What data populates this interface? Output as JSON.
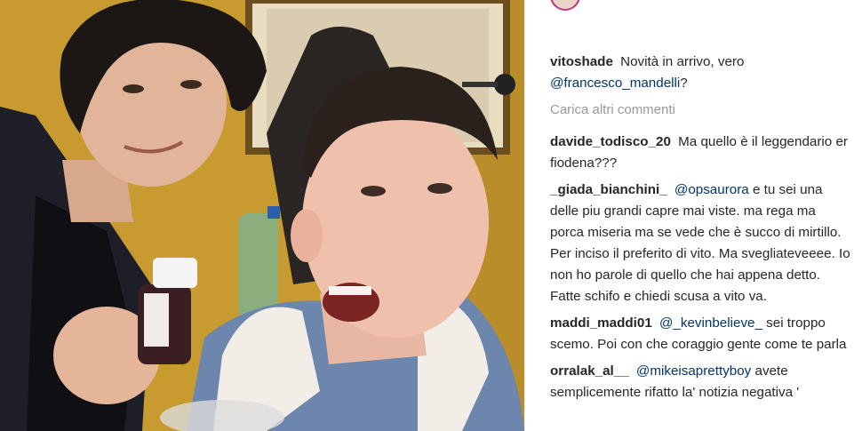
{
  "post": {
    "photo_alt": "Selfie di due uomini, uno con una bottiglia di sciroppo",
    "bottle_label": ""
  },
  "header": {
    "avatar_icon": "profile-avatar-icon"
  },
  "comments": {
    "caption": {
      "user": "vitoshade",
      "text": "Novità in arrivo, vero",
      "mention": "@francesco_mandelli",
      "suffix": "?"
    },
    "load_more": "Carica altri commenti",
    "items": [
      {
        "user": "davide_todisco_20",
        "mention": "",
        "text": "Ma quello è il leggendario er fiodena???"
      },
      {
        "user": "_giada_bianchini_",
        "mention": "@opsaurora",
        "text": "e tu sei una delle piu grandi capre mai viste. ma rega ma porca miseria ma se vede che è succo di mirtillo. Per inciso il preferito di vito. Ma svegliateveeee. Io non ho parole di quello che hai appena detto. Fatte schifo e chiedi scusa a vito va."
      },
      {
        "user": "maddi_maddi01",
        "mention": "@_kevinbelieve_",
        "text": "sei troppo scemo. Poi con che coraggio gente come te parla"
      },
      {
        "user": "orralak_al__",
        "mention": "@mikeisaprettyboy",
        "text": "avete semplicemente rifatto la' notizia negativa '"
      }
    ]
  }
}
